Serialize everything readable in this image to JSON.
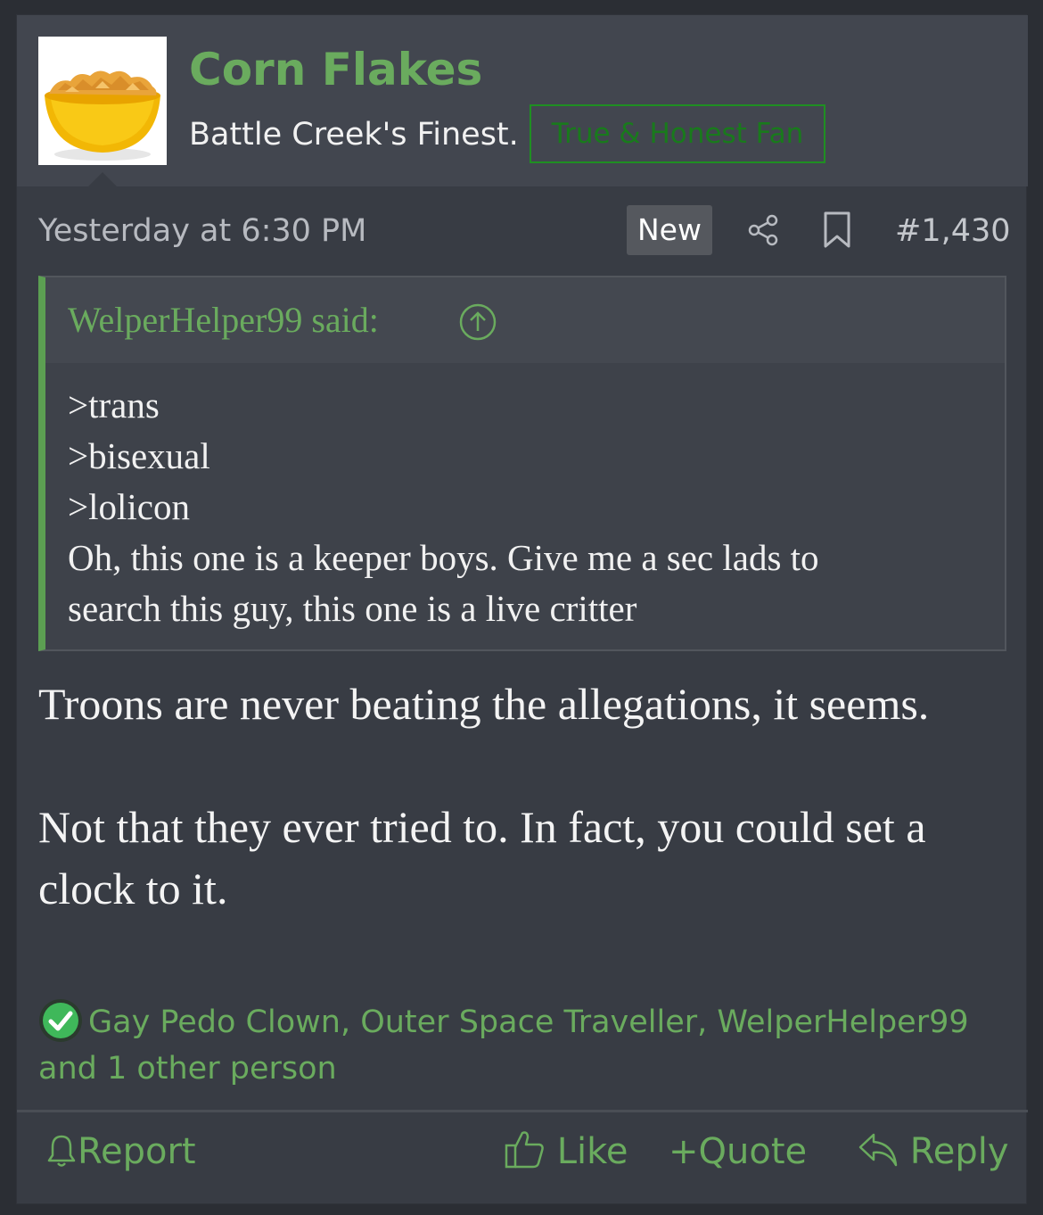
{
  "post": {
    "author": {
      "username": "Corn Flakes",
      "user_title": "Battle Creek's Finest.",
      "banner": "True & Honest Fan"
    },
    "meta": {
      "timestamp": "Yesterday at 6:30 PM",
      "new_badge": "New",
      "post_number": "#1,430"
    },
    "quote": {
      "attribution": "WelperHelper99 said:",
      "lines": [
        ">trans",
        ">bisexual",
        ">lolicon",
        "Oh, this one is a keeper boys. Give me a sec lads to",
        "search this guy, this one is a live critter"
      ]
    },
    "message": {
      "paragraph_1": "Troons are never beating the allegations, it seems.",
      "paragraph_2": "Not that they ever tried to. In fact, you could set a clock to it."
    },
    "reactions": {
      "icon": "checkmark-icon",
      "text": "Gay Pedo Clown, Outer Space Traveller, WelperHelper99 and 1 other person"
    },
    "actions": {
      "report": "Report",
      "like": "Like",
      "quote": "Quote",
      "reply": "Reply"
    },
    "colors": {
      "accent_green": "#6aab5e",
      "background": "#383c44",
      "header_bg": "#42464f"
    }
  }
}
